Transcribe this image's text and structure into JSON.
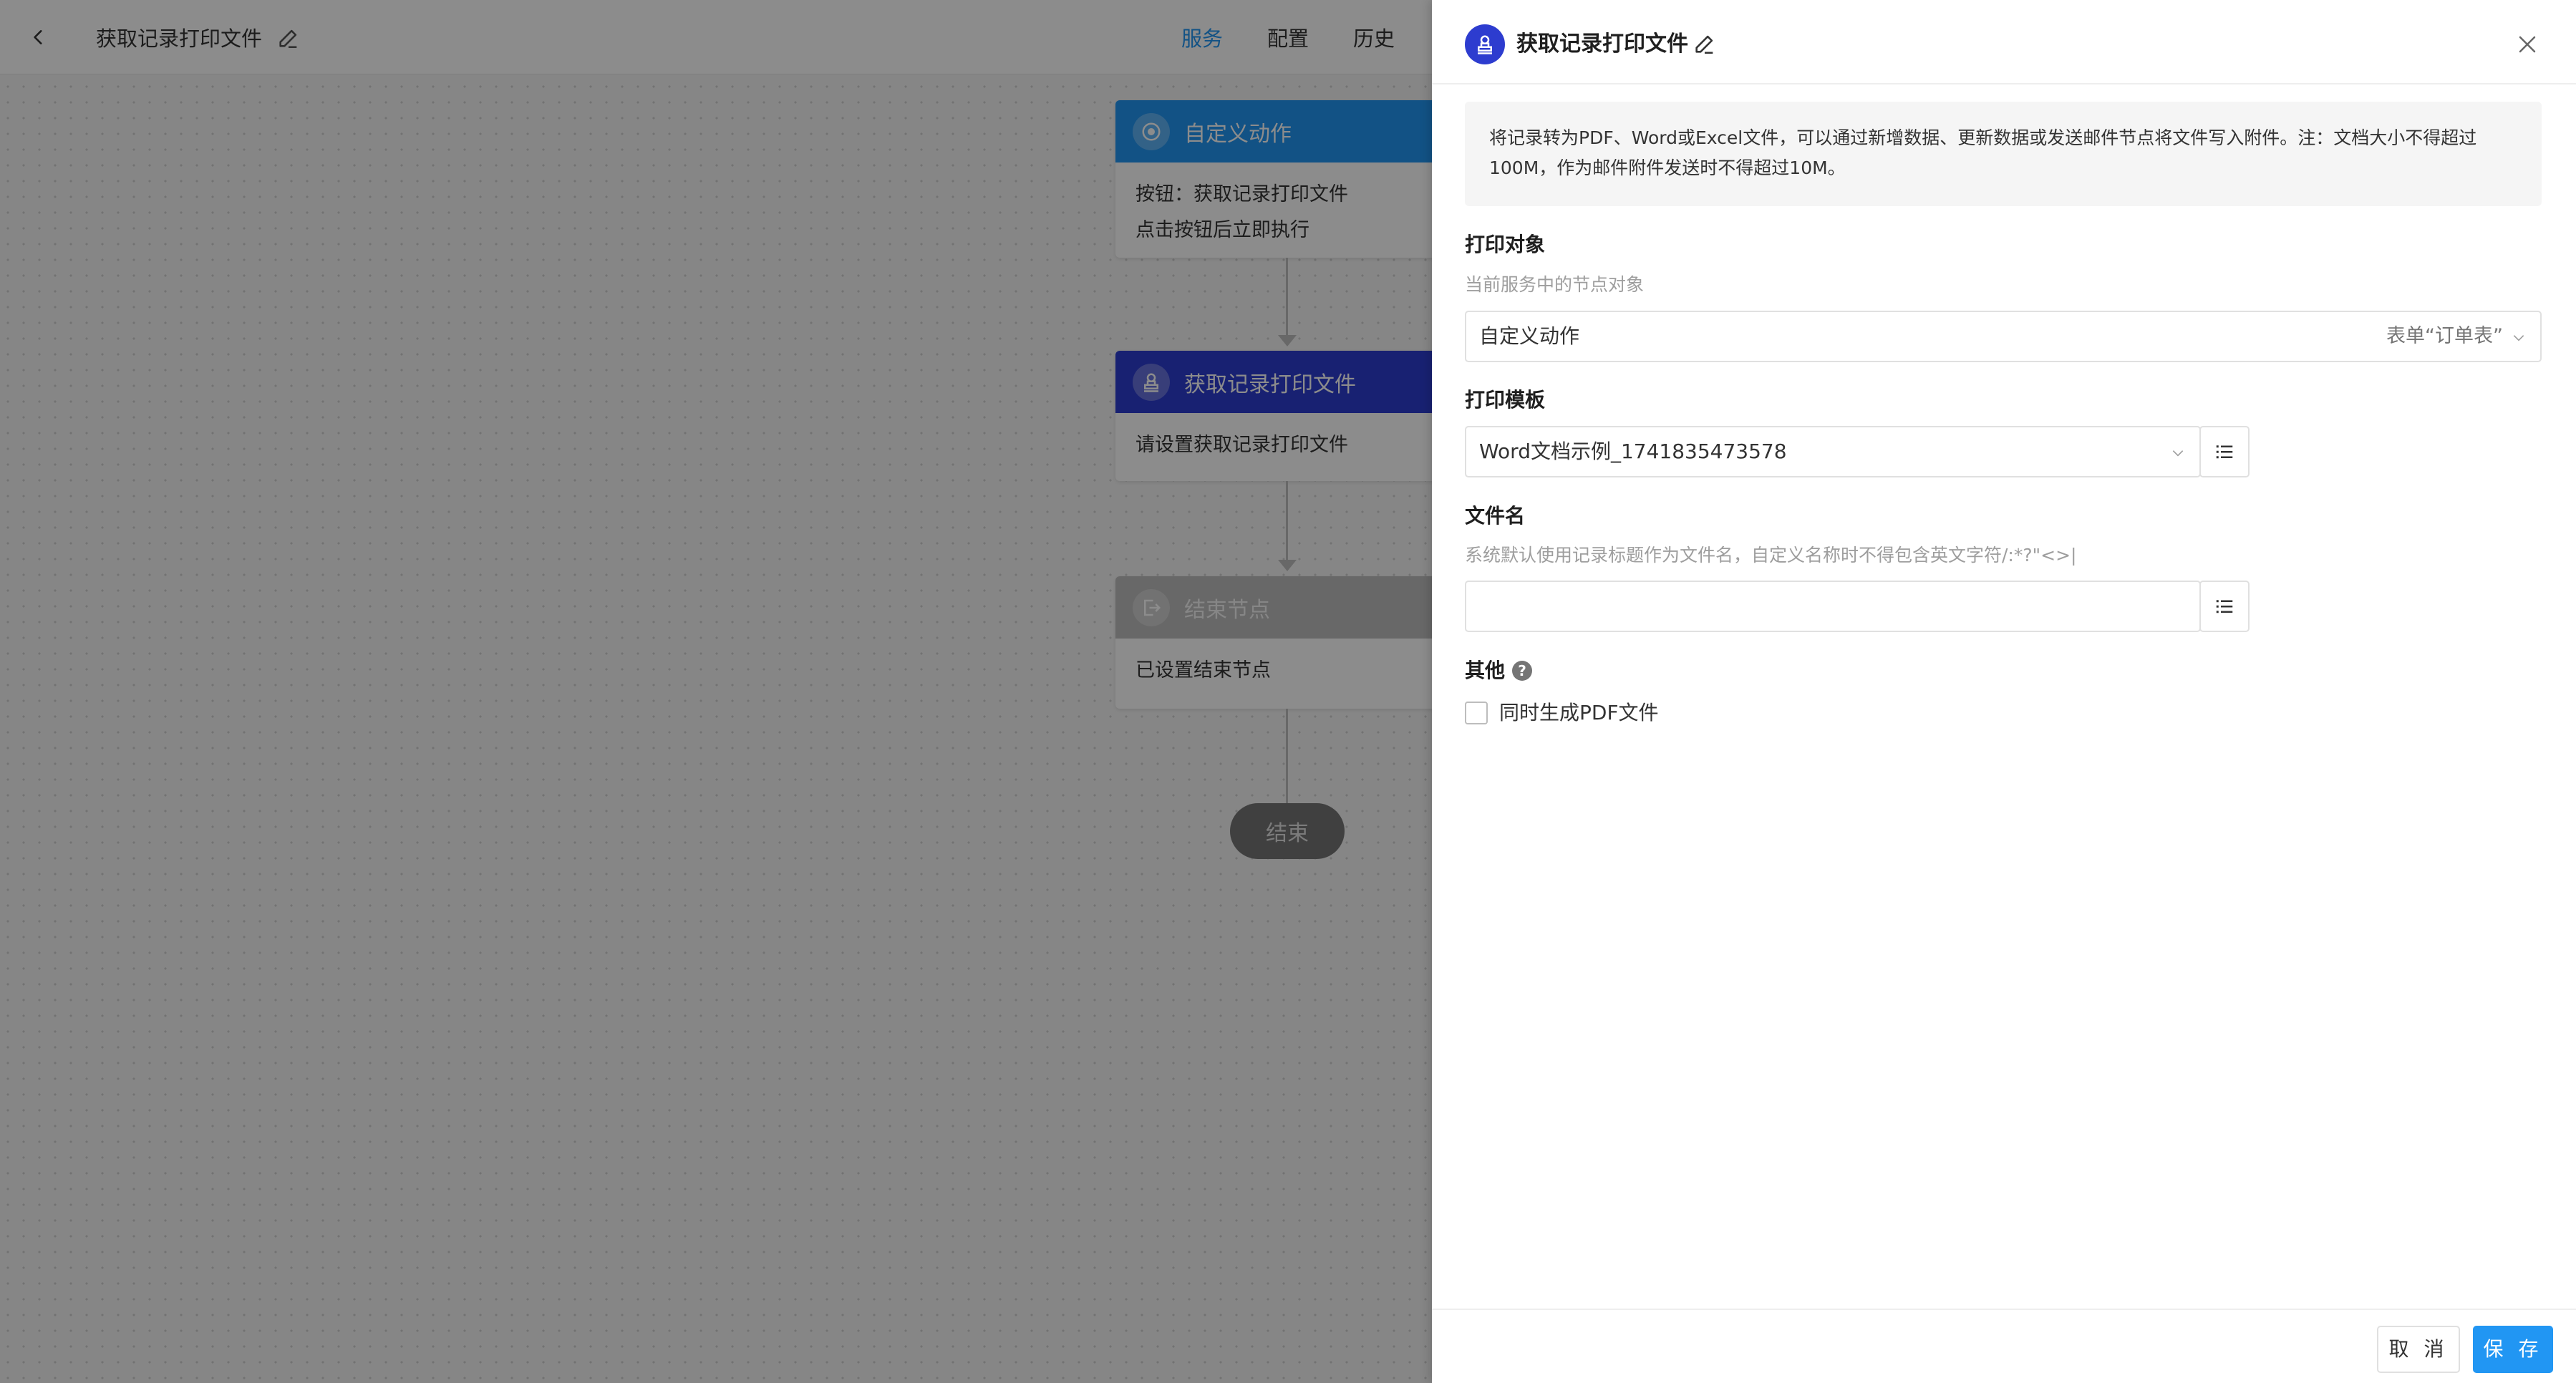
{
  "workspace": {
    "title": "获取记录打印文件",
    "tabs": [
      "服务",
      "配置",
      "历史"
    ],
    "active_tab": "服务",
    "nodes": [
      {
        "title": "自定义动作",
        "lines": [
          "按钮：获取记录打印文件",
          "点击按钮后立即执行"
        ],
        "color": "#2196f3"
      },
      {
        "title": "获取记录打印文件",
        "lines": [
          "请设置获取记录打印文件"
        ],
        "color": "#2d3ccf"
      },
      {
        "title": "结束节点",
        "lines": [
          "已设置结束节点"
        ],
        "color": "#bdbdbd"
      }
    ],
    "end_label": "结束"
  },
  "panel": {
    "title": "获取记录打印文件",
    "notice": "将记录转为PDF、Word或Excel文件，可以通过新增数据、更新数据或发送邮件节点将文件写入附件。注：文档大小不得超过100M，作为邮件附件发送时不得超过10M。",
    "print_target": {
      "label": "打印对象",
      "hint": "当前服务中的节点对象",
      "value": "自定义动作",
      "sub": "表单“订单表”"
    },
    "print_template": {
      "label": "打印模板",
      "value": "Word文档示例_1741835473578"
    },
    "file_name": {
      "label": "文件名",
      "hint": "系统默认使用记录标题作为文件名，自定义名称时不得包含英文字符/:*?\"<>|",
      "value": ""
    },
    "other": {
      "label": "其他",
      "help": "?",
      "pdf_checkbox_label": "同时生成PDF文件",
      "pdf_checked": false
    },
    "cancel_label": "取 消",
    "save_label": "保 存"
  },
  "colors": {
    "accent": "#2196f3",
    "print_node": "#2d3ccf",
    "end_node": "#bdbdbd"
  },
  "icons": [
    "back-icon",
    "edit-icon",
    "target-icon",
    "stamp-icon",
    "exit-icon",
    "close-icon",
    "chevron-down-icon",
    "list-icon",
    "help-icon"
  ]
}
